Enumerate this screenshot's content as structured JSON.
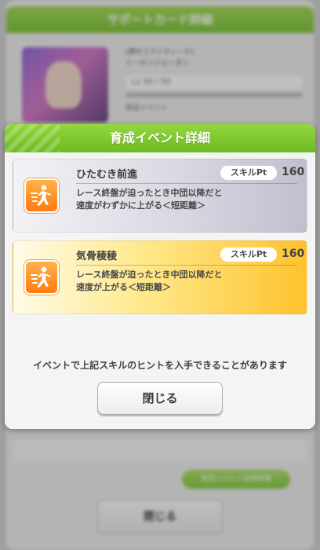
{
  "background": {
    "header_title": "サポートカード詳細",
    "card_title_line1": "[夢叶うアイディーナ]",
    "card_title_line2": "トーセンジョーダン",
    "level_text": "Lv 50 / 50",
    "misc_text": "育成イベント",
    "green_button_label": "育成イベント詳細情報",
    "close_label": "閉じる"
  },
  "modal": {
    "title": "育成イベント詳細",
    "events": [
      {
        "name": "ひたむき前進",
        "pt_label": "スキルPt",
        "pt_value": "160",
        "desc_line1": "レース終盤が迫ったとき中団以降だと",
        "desc_line2": "速度がわずかに上がる＜短距離＞",
        "rarity": "silver"
      },
      {
        "name": "気骨稜稜",
        "pt_label": "スキルPt",
        "pt_value": "160",
        "desc_line1": "レース終盤が迫ったとき中団以降だと",
        "desc_line2": "速度が上がる＜短距離＞",
        "rarity": "gold"
      }
    ],
    "notice": "イベントで上記スキルのヒントを入手できることがあります",
    "close_label": "閉じる"
  },
  "icons": {
    "skill": "running-figure-speed-icon"
  },
  "colors": {
    "header_green": "#6cbb22",
    "silver_card": "#bfbfcf",
    "gold_card": "#ffc22e",
    "icon_orange": "#ff7b12"
  }
}
